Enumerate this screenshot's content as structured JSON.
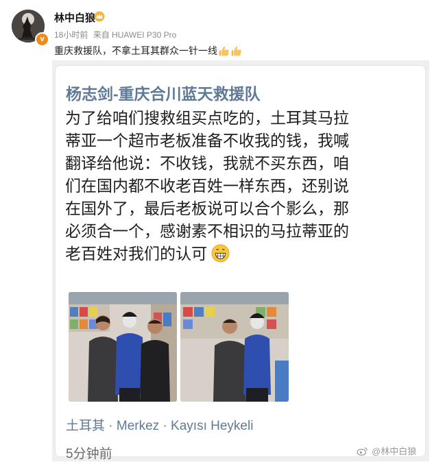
{
  "post": {
    "username": "林中白狼",
    "meta": {
      "time": "18小时前",
      "source": "来自 HUAWEI P30 Pro"
    },
    "text": "重庆救援队，不拿土耳其群众一针一线",
    "text_icons": [
      "thumbs-up-icon",
      "thumbs-up-icon"
    ],
    "badge_icon": "crown-icon",
    "verified_icon": "verified-v-icon"
  },
  "embedded": {
    "author": "杨志剑-重庆合川蓝天救援队",
    "body_lines": [
      "为了给咱们搜救组买点吃的，土耳其马拉",
      "蒂亚一个超市老板准备不收我的钱，我喊",
      "翻译给他说：不收钱，我就不买东西，咱",
      "们在国内都不收老百姓一样东西，还别说",
      "在国外了，最后老板说可以合个影么，那",
      "必须合一个，感谢素不相识的马拉蒂亚的",
      "老百姓对我们的认可"
    ],
    "trailing_emoji": "grinning-face-icon",
    "location": "土耳其 · Merkez · Kayısı Heykeli",
    "time_ago": "5分钟前"
  },
  "watermark": {
    "text": "@林中白狼",
    "icon": "weibo-icon"
  },
  "colors": {
    "link_blue": "#5f7a98",
    "meta_gray": "#8a8a8a",
    "badge_orange": "#f28a1a",
    "embed_bg": "#efefef"
  }
}
